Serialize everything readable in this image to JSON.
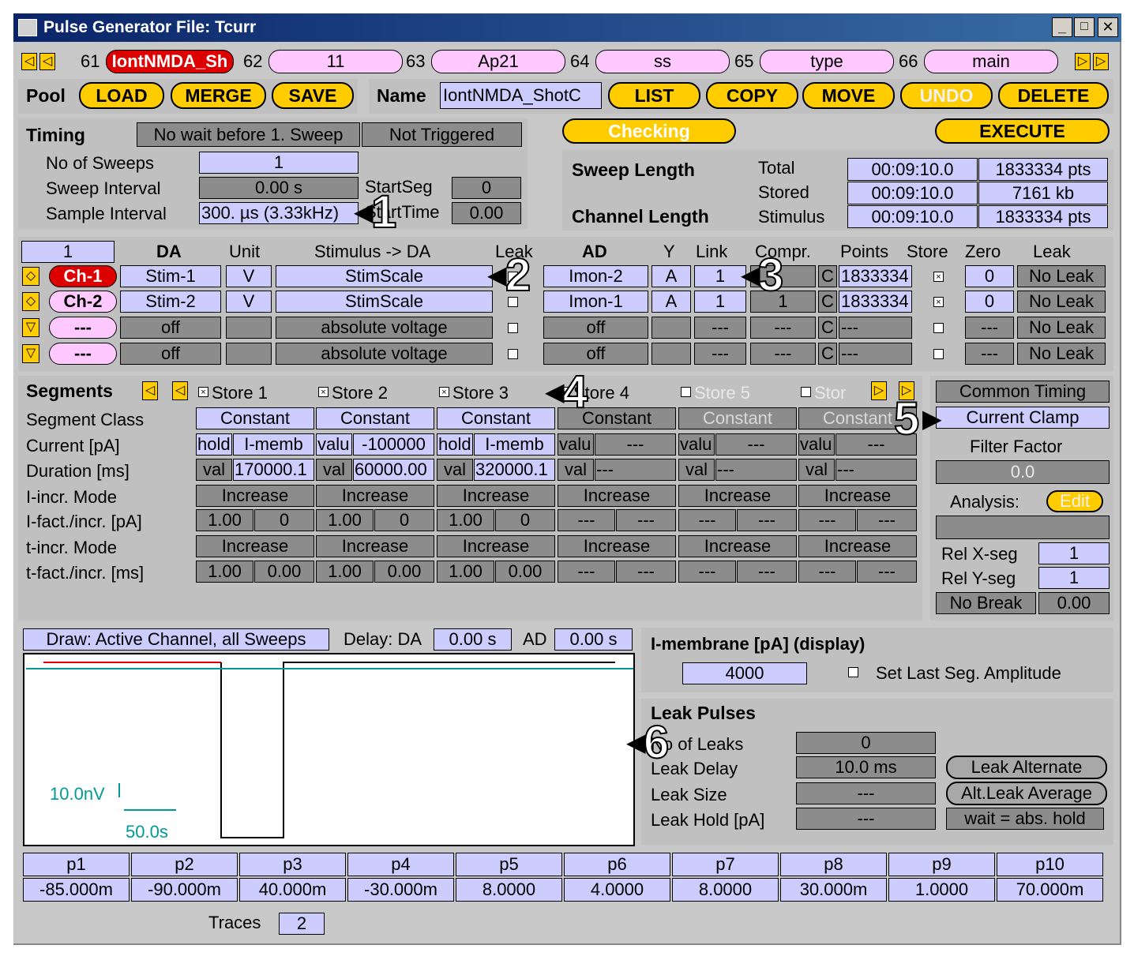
{
  "window": {
    "title": "Pulse Generator File:  Tcurr"
  },
  "seq_bar": {
    "items": [
      {
        "num": "61",
        "name": "IontNMDA_Sh"
      },
      {
        "num": "62",
        "name": "11"
      },
      {
        "num": "63",
        "name": "Ap21"
      },
      {
        "num": "64",
        "name": "ss"
      },
      {
        "num": "65",
        "name": "type"
      },
      {
        "num": "66",
        "name": "main"
      }
    ]
  },
  "pool": {
    "label": "Pool",
    "buttons": [
      "LOAD",
      "MERGE",
      "SAVE"
    ]
  },
  "name_row": {
    "label": "Name",
    "value": "IontNMDA_ShotC",
    "buttons": [
      "LIST",
      "COPY",
      "MOVE",
      "UNDO",
      "DELETE"
    ]
  },
  "timing": {
    "label": "Timing",
    "wait": "No wait before 1. Sweep",
    "trigger": "Not Triggered",
    "sweeps_label": "No of Sweeps",
    "sweeps": "1",
    "interval_label": "Sweep Interval",
    "interval": "0.00 s",
    "sample_label": "Sample Interval",
    "sample": "300. µs  (3.33kHz)",
    "startseg_label": "StartSeg",
    "startseg": "0",
    "starttime_label": "StartTime",
    "starttime": "0.00"
  },
  "status": {
    "checking": "Checking",
    "execute": "EXECUTE"
  },
  "lengths": {
    "sweep_label": "Sweep Length",
    "channel_label": "Channel Length",
    "total_label": "Total",
    "stored_label": "Stored",
    "stimulus_label": "Stimulus",
    "total_time": "00:09:10.0",
    "total_pts": "1833334 pts",
    "stored_time": "00:09:10.0",
    "stored_kb": "7161 kb",
    "stim_time": "00:09:10.0",
    "stim_pts": "1833334 pts"
  },
  "channels": {
    "count": "1",
    "headers": {
      "da": "DA",
      "unit": "Unit",
      "stim": "Stimulus -> DA",
      "leak": "Leak",
      "ad": "AD",
      "y": "Y",
      "link": "Link",
      "compr": "Compr.",
      "points": "Points",
      "store": "Store",
      "zero": "Zero",
      "leak2": "Leak"
    },
    "rows": [
      {
        "ch": "Ch-1",
        "da": "Stim-1",
        "unit": "V",
        "stim": "StimScale",
        "ad": "Imon-2",
        "y": "A",
        "link": "1",
        "compr": "",
        "c": "C",
        "points": "1833334",
        "zero": "0",
        "leak": "No Leak"
      },
      {
        "ch": "Ch-2",
        "da": "Stim-2",
        "unit": "V",
        "stim": "StimScale",
        "ad": "Imon-1",
        "y": "A",
        "link": "1",
        "compr": "1",
        "c": "C",
        "points": "1833334",
        "zero": "0",
        "leak": "No Leak"
      },
      {
        "ch": "---",
        "da": "off",
        "unit": "",
        "stim": "absolute voltage",
        "ad": "off",
        "y": "",
        "link": "---",
        "compr": "---",
        "c": "C",
        "points": "---",
        "zero": "---",
        "leak": "No Leak"
      },
      {
        "ch": "---",
        "da": "off",
        "unit": "",
        "stim": "absolute voltage",
        "ad": "off",
        "y": "",
        "link": "---",
        "compr": "---",
        "c": "C",
        "points": "---",
        "zero": "---",
        "leak": "No Leak"
      }
    ]
  },
  "segments": {
    "label": "Segments",
    "row_labels": [
      "Segment Class",
      "Current [pA]",
      "Duration [ms]",
      "I-incr. Mode",
      "I-fact./incr. [pA]",
      "t-incr. Mode",
      "t-fact./incr. [ms]"
    ],
    "cols": [
      {
        "store": "Store 1",
        "cls": "Constant",
        "cur_a": "hold",
        "cur_b": "I-memb",
        "dur_a": "val",
        "dur_b": "170000.1",
        "imode": "Increase",
        "if_a": "1.00",
        "if_b": "0",
        "tmode": "Increase",
        "tf_a": "1.00",
        "tf_b": "0.00"
      },
      {
        "store": "Store 2",
        "cls": "Constant",
        "cur_a": "valu",
        "cur_b": "-100000",
        "dur_a": "val",
        "dur_b": "60000.00",
        "imode": "Increase",
        "if_a": "1.00",
        "if_b": "0",
        "tmode": "Increase",
        "tf_a": "1.00",
        "tf_b": "0.00"
      },
      {
        "store": "Store 3",
        "cls": "Constant",
        "cur_a": "hold",
        "cur_b": "I-memb",
        "dur_a": "val",
        "dur_b": "320000.1",
        "imode": "Increase",
        "if_a": "1.00",
        "if_b": "0",
        "tmode": "Increase",
        "tf_a": "1.00",
        "tf_b": "0.00"
      },
      {
        "store": "Store 4",
        "cls": "Constant",
        "cur_a": "valu",
        "cur_b": "---",
        "dur_a": "val",
        "dur_b": "---",
        "imode": "Increase",
        "if_a": "---",
        "if_b": "---",
        "tmode": "Increase",
        "tf_a": "---",
        "tf_b": "---"
      },
      {
        "store": "Store 5",
        "cls": "Constant",
        "cur_a": "valu",
        "cur_b": "---",
        "dur_a": "val",
        "dur_b": "---",
        "imode": "Increase",
        "if_a": "---",
        "if_b": "---",
        "tmode": "Increase",
        "tf_a": "---",
        "tf_b": "---"
      },
      {
        "store": "Stor",
        "cls": "Constant",
        "cur_a": "valu",
        "cur_b": "---",
        "dur_a": "val",
        "dur_b": "---",
        "imode": "Increase",
        "if_a": "---",
        "if_b": "---",
        "tmode": "Increase",
        "tf_a": "---",
        "tf_b": "---"
      }
    ]
  },
  "side": {
    "common_timing": "Common Timing",
    "clamp": "Current Clamp",
    "filter_label": "Filter Factor",
    "filter": "0.0",
    "analysis_label": "Analysis:",
    "edit": "Edit",
    "relx_label": "Rel X-seg",
    "relx": "1",
    "rely_label": "Rel Y-seg",
    "rely": "1",
    "nobreak": "No Break",
    "break_val": "0.00"
  },
  "draw": {
    "mode": "Draw: Active Channel, all Sweeps",
    "delay_da_label": "Delay: DA",
    "delay_da": "0.00 s",
    "ad_label": "AD",
    "delay_ad": "0.00 s",
    "scale_y": "10.0nV",
    "scale_x": "50.0s"
  },
  "imem": {
    "label": "I-membrane [pA]  (display)",
    "value": "4000",
    "set_last": "Set Last Seg. Amplitude"
  },
  "leak": {
    "title": "Leak Pulses",
    "n_label": "No of Leaks",
    "n": "0",
    "delay_label": "Leak Delay",
    "delay": "10.0 ms",
    "size_label": "Leak Size",
    "size": "---",
    "hold_label": "Leak Hold [pA]",
    "hold": "---",
    "alternate": "Leak Alternate",
    "average": "Alt.Leak Average",
    "wait": "wait = abs. hold"
  },
  "params": [
    {
      "name": "p1",
      "value": "-85.000m"
    },
    {
      "name": "p2",
      "value": "-90.000m"
    },
    {
      "name": "p3",
      "value": "40.000m"
    },
    {
      "name": "p4",
      "value": "-30.000m"
    },
    {
      "name": "p5",
      "value": "8.0000"
    },
    {
      "name": "p6",
      "value": "4.0000"
    },
    {
      "name": "p7",
      "value": "8.0000"
    },
    {
      "name": "p8",
      "value": "30.000m"
    },
    {
      "name": "p9",
      "value": "1.0000"
    },
    {
      "name": "p10",
      "value": "70.000m"
    }
  ],
  "traces": {
    "label": "Traces",
    "value": "2"
  },
  "callouts": [
    "1",
    "2",
    "3",
    "4",
    "5",
    "6"
  ],
  "colors": {
    "yellow": "#ffcc00",
    "lavender": "#ccccff",
    "pink": "#ffc8ff",
    "red": "#dd0000",
    "trace_red": "#e00000",
    "trace_teal": "#009999"
  }
}
